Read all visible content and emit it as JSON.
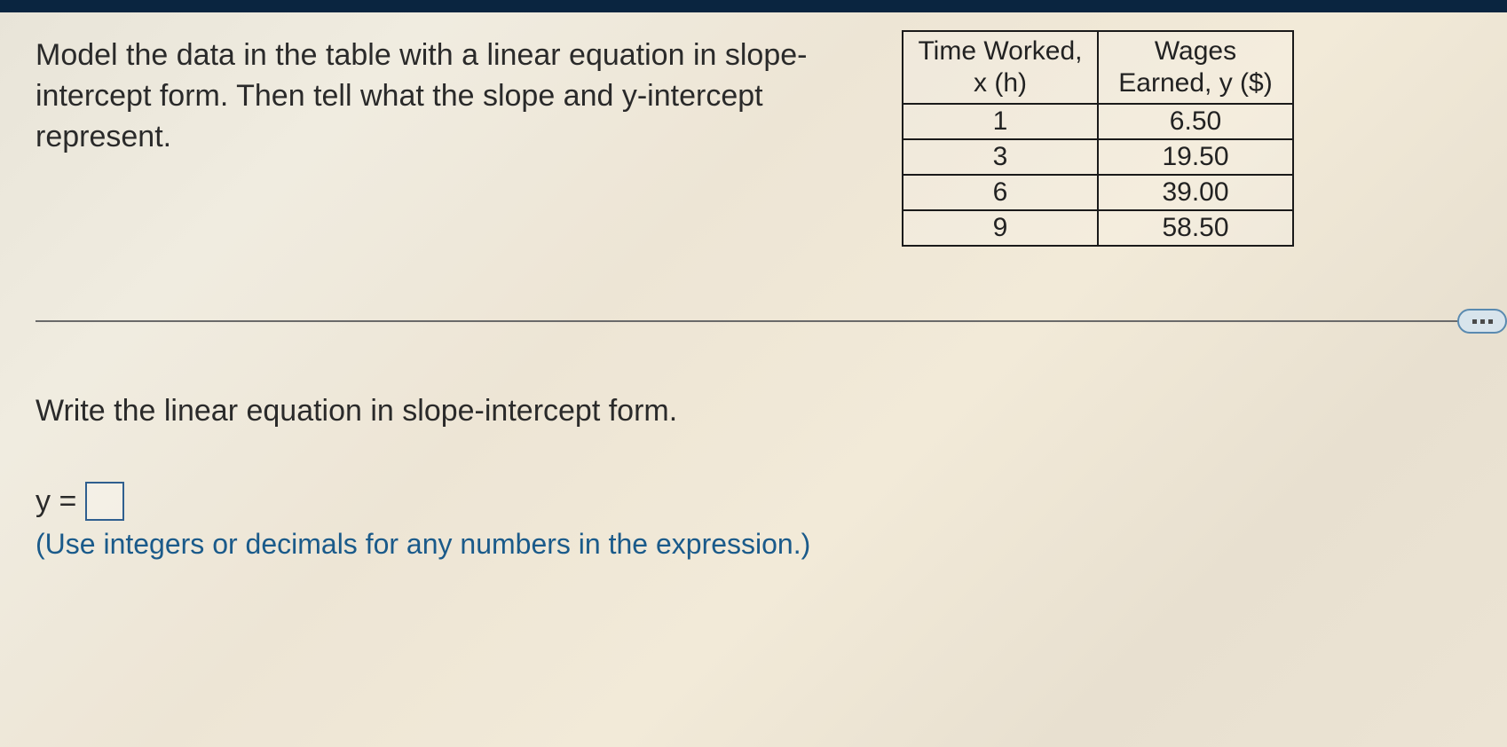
{
  "problem": {
    "text": "Model the data in the table with a linear equation in slope-intercept form. Then tell what the slope and y-intercept represent."
  },
  "table": {
    "headers": {
      "x": "Time Worked, x (h)",
      "y": "Wages Earned, y ($)"
    },
    "rows": [
      {
        "x": "1",
        "y": "6.50"
      },
      {
        "x": "3",
        "y": "19.50"
      },
      {
        "x": "6",
        "y": "39.00"
      },
      {
        "x": "9",
        "y": "58.50"
      }
    ]
  },
  "lower": {
    "instruction": "Write the linear equation in slope-intercept form.",
    "equation_label": "y =",
    "answer_value": "",
    "hint": "(Use integers or decimals for any numbers in the expression.)"
  },
  "chart_data": {
    "type": "table",
    "columns": [
      "Time Worked, x (h)",
      "Wages Earned, y ($)"
    ],
    "data": [
      [
        1,
        6.5
      ],
      [
        3,
        19.5
      ],
      [
        6,
        39.0
      ],
      [
        9,
        58.5
      ]
    ]
  }
}
